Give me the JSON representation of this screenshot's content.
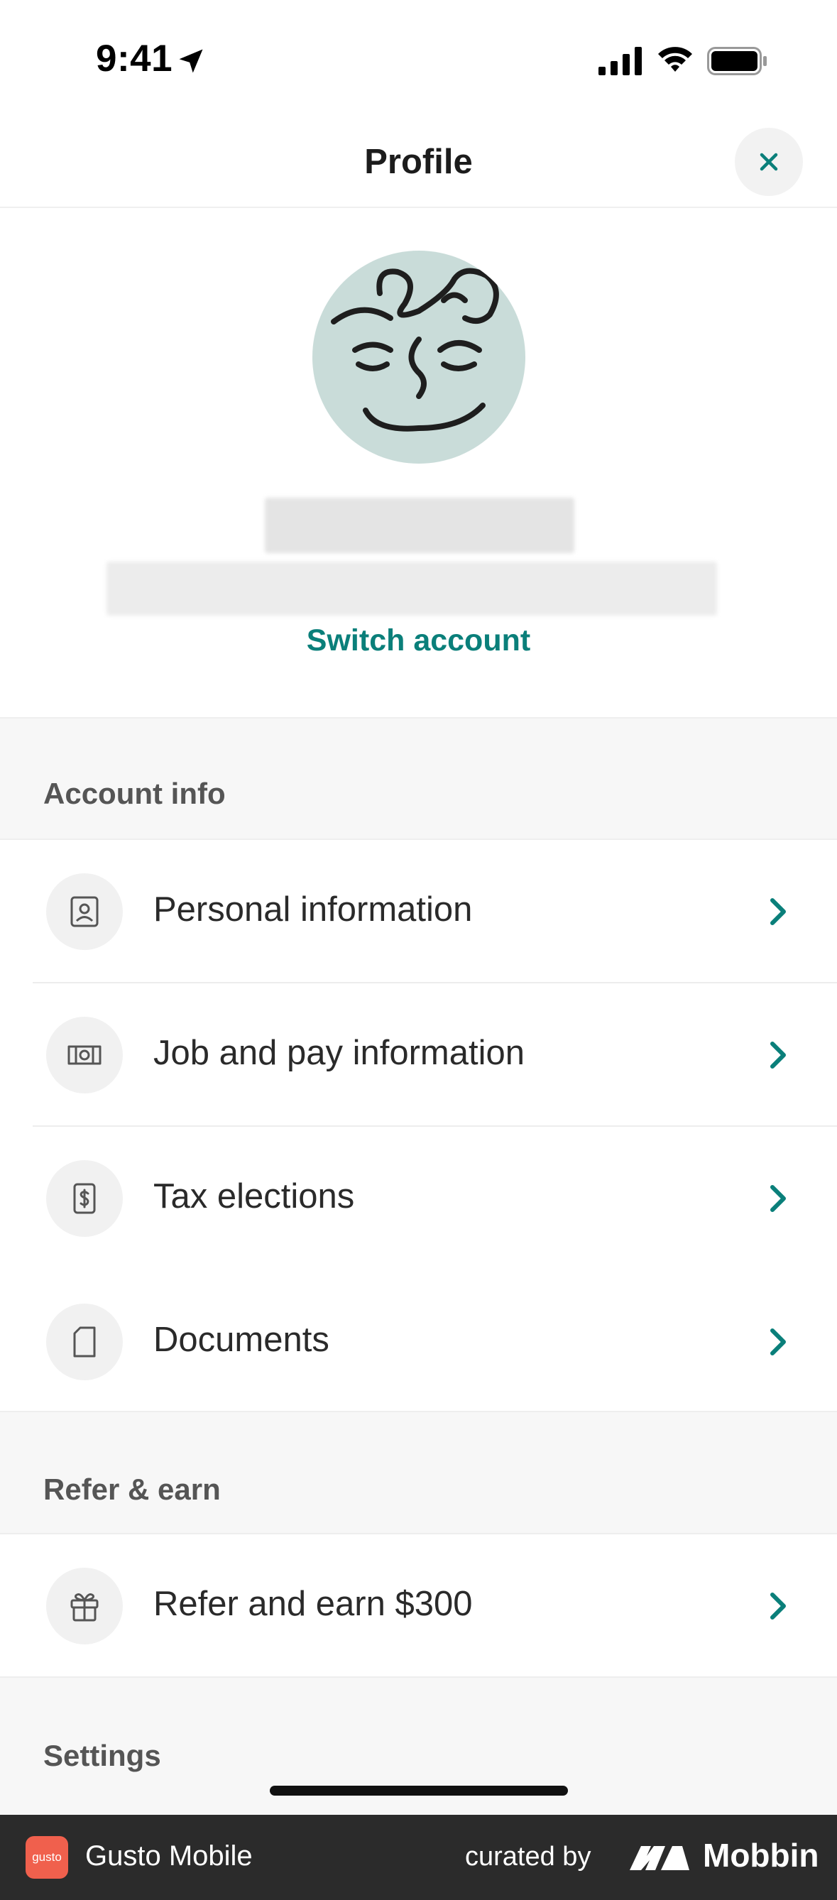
{
  "status_bar": {
    "time": "9:41"
  },
  "header": {
    "title": "Profile"
  },
  "profile": {
    "switch_account": "Switch account"
  },
  "sections": {
    "account_info": {
      "label": "Account info",
      "items": [
        {
          "label": "Personal information",
          "icon": "person-card-icon"
        },
        {
          "label": "Job and pay information",
          "icon": "money-bill-icon"
        },
        {
          "label": "Tax elections",
          "icon": "dollar-document-icon"
        },
        {
          "label": "Documents",
          "icon": "document-icon"
        }
      ]
    },
    "refer_earn": {
      "label": "Refer & earn",
      "items": [
        {
          "label": "Refer and earn $300",
          "icon": "gift-icon"
        }
      ]
    },
    "settings": {
      "label": "Settings"
    }
  },
  "footer": {
    "logo_text": "gusto",
    "app_name": "Gusto Mobile",
    "curated_by": "curated by",
    "brand": "Mobbin"
  },
  "colors": {
    "accent": "#0a7f7a",
    "avatar_bg": "#c9dcd9",
    "section_bg": "#f7f7f7",
    "footer_bg": "#2b2b2b",
    "footer_logo": "#f0604d"
  }
}
